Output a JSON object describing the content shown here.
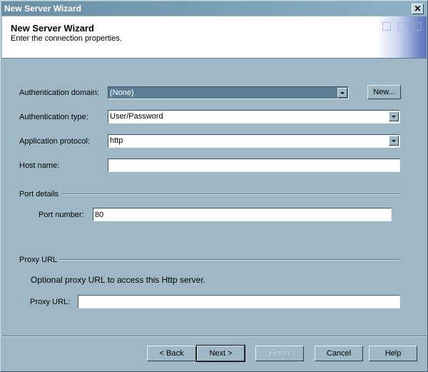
{
  "window": {
    "title": "New Server Wizard",
    "close_icon": "close-icon"
  },
  "header": {
    "title": "New Server Wizard",
    "subtitle": "Enter the connection properties."
  },
  "form": {
    "auth_domain": {
      "label": "Authentication domain:",
      "value": "(None)",
      "new_button": "New..."
    },
    "auth_type": {
      "label": "Authentication type:",
      "value": "User/Password"
    },
    "app_protocol": {
      "label": "Application protocol:",
      "value": "http"
    },
    "host_name": {
      "label": "Host name:",
      "value": ""
    },
    "port_section": {
      "title": "Port details",
      "port_label": "Port number:",
      "port_value": "80"
    },
    "proxy_section": {
      "title": "Proxy URL",
      "description": "Optional proxy URL to access this Http server.",
      "proxy_label": "Proxy URL:",
      "proxy_value": ""
    }
  },
  "buttons": {
    "back": "< Back",
    "next": "Next >",
    "finish": "Finish",
    "cancel": "Cancel",
    "help": "Help"
  }
}
